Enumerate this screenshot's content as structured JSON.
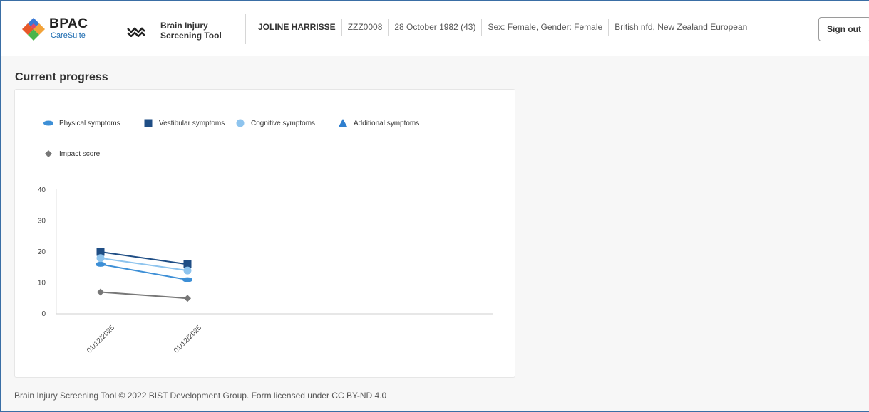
{
  "header": {
    "logo_title": "BPAC",
    "logo_subtitle": "CareSuite",
    "tool_name_line1": "Brain Injury",
    "tool_name_line2": "Screening Tool",
    "patient": {
      "name": "JOLINE HARRISSE",
      "nhi": "ZZZ0008",
      "dob": "28 October 1982 (43)",
      "sex_gender": "Sex: Female, Gender: Female",
      "ethnicity": "British nfd, New Zealand European"
    },
    "sign_out_label": "Sign out"
  },
  "main": {
    "title": "Current progress"
  },
  "chart_data": {
    "type": "line",
    "categories": [
      "01/12/2025",
      "01/12/2025"
    ],
    "series": [
      {
        "name": "Physical symptoms",
        "values": [
          16,
          11
        ],
        "color": "#3d8fd6",
        "marker": "ellipse"
      },
      {
        "name": "Vestibular symptoms",
        "values": [
          20,
          16
        ],
        "color": "#1f4e85",
        "marker": "square"
      },
      {
        "name": "Cognitive symptoms",
        "values": [
          18,
          14
        ],
        "color": "#8ec4ee",
        "marker": "circle"
      },
      {
        "name": "Additional symptoms",
        "values": [],
        "color": "#2f7fcf",
        "marker": "triangle"
      },
      {
        "name": "Impact score",
        "values": [
          7,
          5
        ],
        "color": "#777777",
        "marker": "diamond"
      }
    ],
    "ylim": [
      0,
      40
    ],
    "yticks": [
      0,
      10,
      20,
      30,
      40
    ],
    "xlabel": "",
    "ylabel": "",
    "grid": false,
    "legend_position": "top-left"
  },
  "footer": {
    "text": "Brain Injury Screening Tool © 2022 BIST Development Group. Form licensed under CC BY-ND 4.0"
  }
}
